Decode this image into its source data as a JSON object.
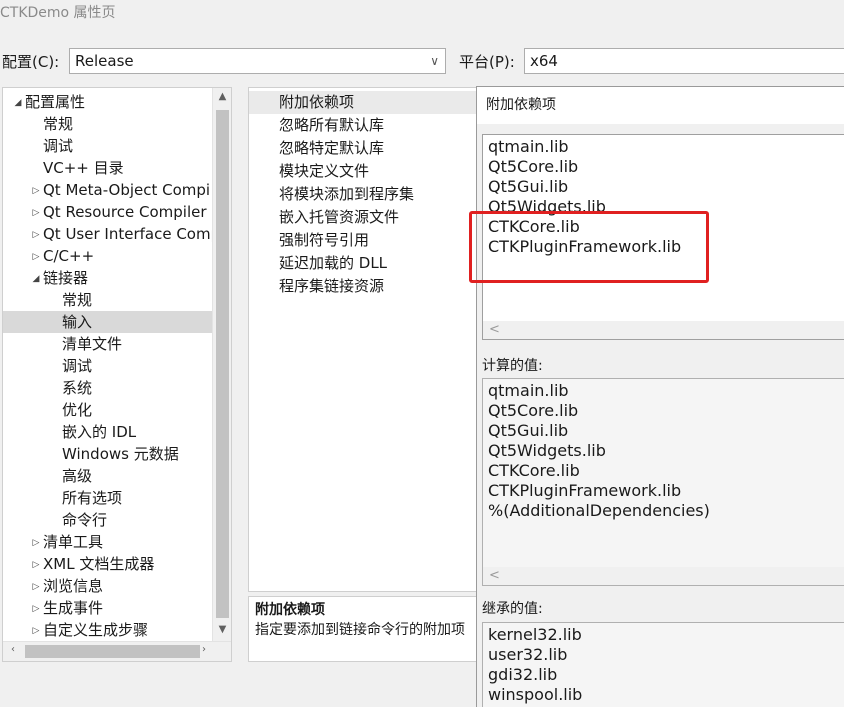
{
  "window": {
    "title": "CTKDemo 属性页"
  },
  "config": {
    "label": "配置(C):",
    "value": "Release",
    "platform_label": "平台(P):",
    "platform_value": "x64"
  },
  "tree": {
    "items": [
      {
        "label": "配置属性",
        "level": 0,
        "expander": "down"
      },
      {
        "label": "常规",
        "level": 1,
        "expander": ""
      },
      {
        "label": "调试",
        "level": 1,
        "expander": ""
      },
      {
        "label": "VC++ 目录",
        "level": 1,
        "expander": ""
      },
      {
        "label": "Qt Meta-Object Compi",
        "level": 1,
        "expander": "right"
      },
      {
        "label": "Qt Resource Compiler",
        "level": 1,
        "expander": "right"
      },
      {
        "label": "Qt User Interface Comp",
        "level": 1,
        "expander": "right"
      },
      {
        "label": "C/C++",
        "level": 1,
        "expander": "right"
      },
      {
        "label": "链接器",
        "level": 1,
        "expander": "down"
      },
      {
        "label": "常规",
        "level": 2,
        "expander": ""
      },
      {
        "label": "输入",
        "level": 2,
        "expander": "",
        "selected": true
      },
      {
        "label": "清单文件",
        "level": 2,
        "expander": ""
      },
      {
        "label": "调试",
        "level": 2,
        "expander": ""
      },
      {
        "label": "系统",
        "level": 2,
        "expander": ""
      },
      {
        "label": "优化",
        "level": 2,
        "expander": ""
      },
      {
        "label": "嵌入的 IDL",
        "level": 2,
        "expander": ""
      },
      {
        "label": "Windows 元数据",
        "level": 2,
        "expander": ""
      },
      {
        "label": "高级",
        "level": 2,
        "expander": ""
      },
      {
        "label": "所有选项",
        "level": 2,
        "expander": ""
      },
      {
        "label": "命令行",
        "level": 2,
        "expander": ""
      },
      {
        "label": "清单工具",
        "level": 1,
        "expander": "right"
      },
      {
        "label": "XML 文档生成器",
        "level": 1,
        "expander": "right"
      },
      {
        "label": "浏览信息",
        "level": 1,
        "expander": "right"
      },
      {
        "label": "生成事件",
        "level": 1,
        "expander": "right"
      },
      {
        "label": "自定义生成步骤",
        "level": 1,
        "expander": "right"
      }
    ]
  },
  "properties": {
    "items": [
      {
        "label": "附加依赖项",
        "selected": true
      },
      {
        "label": "忽略所有默认库"
      },
      {
        "label": "忽略特定默认库"
      },
      {
        "label": "模块定义文件"
      },
      {
        "label": "将模块添加到程序集"
      },
      {
        "label": "嵌入托管资源文件"
      },
      {
        "label": "强制符号引用"
      },
      {
        "label": "延迟加载的 DLL"
      },
      {
        "label": "程序集链接资源"
      }
    ],
    "description_title": "附加依赖项",
    "description_text": "指定要添加到链接命令行的附加项"
  },
  "dialog": {
    "title": "附加依赖项",
    "edit_lines": [
      "qtmain.lib",
      "Qt5Core.lib",
      "Qt5Gui.lib",
      "Qt5Widgets.lib",
      "CTKCore.lib",
      "CTKPluginFramework.lib"
    ],
    "computed_label": "计算的值:",
    "computed_lines": [
      "qtmain.lib",
      "Qt5Core.lib",
      "Qt5Gui.lib",
      "Qt5Widgets.lib",
      "CTKCore.lib",
      "CTKPluginFramework.lib",
      "%(AdditionalDependencies)"
    ],
    "inherited_label": "继承的值:",
    "inherited_lines": [
      "kernel32.lib",
      "user32.lib",
      "gdi32.lib",
      "winspool.lib"
    ],
    "scroll_left": "<"
  },
  "colors": {
    "highlight": "#e02020",
    "selection": "#d9d9d9"
  },
  "icons": {
    "dropdown": "chevron-down-icon",
    "expand": "triangle-right-icon",
    "collapse": "triangle-down-icon"
  }
}
